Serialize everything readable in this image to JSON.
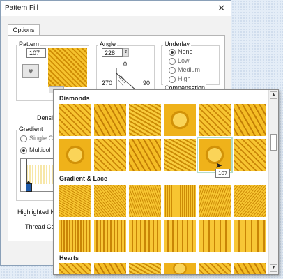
{
  "window": {
    "title": "Pattern Fill",
    "close_glyph": "✕"
  },
  "tabs": [
    {
      "label": "Options"
    }
  ],
  "pattern": {
    "group_label": "Pattern",
    "number": "107"
  },
  "angle": {
    "group_label": "Angle",
    "value": "228",
    "mark_top": "0",
    "mark_left": "270",
    "mark_right": "90"
  },
  "underlay": {
    "group_label": "Underlay",
    "options": [
      "None",
      "Low",
      "Medium",
      "High"
    ],
    "selected": "None"
  },
  "compensation": {
    "group_label": "Compensation"
  },
  "density": {
    "label": "Density"
  },
  "gradient": {
    "group_label": "Gradient",
    "single_label": "Single C",
    "multi_label": "Multicol"
  },
  "highlighted": {
    "label": "Highlighted N"
  },
  "thread": {
    "label": "Thread Col"
  },
  "popup": {
    "sections": [
      {
        "title": "Diamonds"
      },
      {
        "title": "Gradient & Lace"
      },
      {
        "title": "Hearts"
      }
    ],
    "tooltip": "107"
  }
}
